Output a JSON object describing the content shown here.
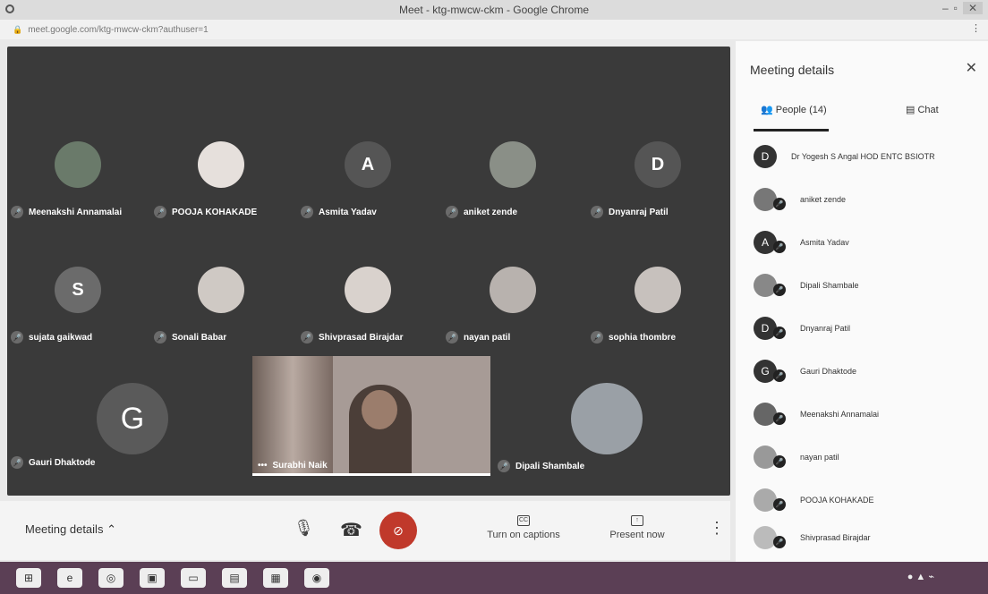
{
  "window": {
    "title": "Meet - ktg-mwcw-ckm - Google Chrome",
    "url": "meet.google.com/ktg-mwcw-ckm?authuser=1"
  },
  "tiles": [
    {
      "name": "Meenakshi Annamalai",
      "avatar": ""
    },
    {
      "name": "POOJA KOHAKADE",
      "avatar": ""
    },
    {
      "name": "Asmita Yadav",
      "avatar": "A"
    },
    {
      "name": "aniket zende",
      "avatar": ""
    },
    {
      "name": "Dnyanraj Patil",
      "avatar": "D"
    },
    {
      "name": "sujata gaikwad",
      "avatar": "S"
    },
    {
      "name": "Sonali Babar",
      "avatar": ""
    },
    {
      "name": "Shivprasad Birajdar",
      "avatar": ""
    },
    {
      "name": "nayan patil",
      "avatar": ""
    },
    {
      "name": "sophia thombre",
      "avatar": ""
    },
    {
      "name": "Gauri Dhaktode",
      "avatar": "G"
    },
    {
      "name": "Dipali Shambale",
      "avatar": ""
    }
  ],
  "main_video": {
    "name": "Surabhi Naik"
  },
  "bottom": {
    "meeting_details": "Meeting details",
    "captions": "Turn on captions",
    "present": "Present now"
  },
  "panel": {
    "title": "Meeting details",
    "people_tab": "People (14)",
    "chat_tab": "Chat",
    "people": [
      {
        "avatar": "D",
        "name": "Dr Yogesh S Angal HOD ENTC BSIOTR"
      },
      {
        "avatar": "",
        "name": "aniket zende"
      },
      {
        "avatar": "A",
        "name": "Asmita Yadav"
      },
      {
        "avatar": "",
        "name": "Dipali Shambale"
      },
      {
        "avatar": "D",
        "name": "Dnyanraj Patil"
      },
      {
        "avatar": "G",
        "name": "Gauri Dhaktode"
      },
      {
        "avatar": "",
        "name": "Meenakshi Annamalai"
      },
      {
        "avatar": "",
        "name": "nayan patil"
      },
      {
        "avatar": "",
        "name": "POOJA KOHAKADE"
      },
      {
        "avatar": "",
        "name": "Shivprasad Birajdar"
      }
    ]
  },
  "colors": {
    "stage": "#3a3a3a",
    "hangup_bg": "#c0392b",
    "taskbar": "#5b3f55"
  }
}
